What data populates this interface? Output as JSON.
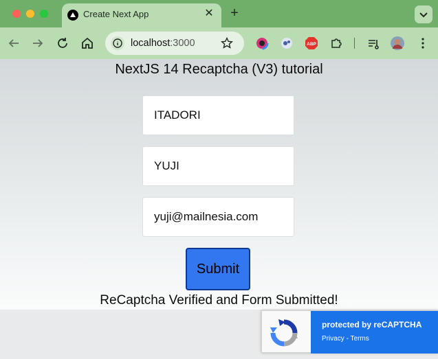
{
  "browser": {
    "tab_title": "Create Next App",
    "tab_close": "✕",
    "new_tab": "+",
    "url_host": "localhost",
    "url_port": ":3000",
    "icons": [
      "back-icon",
      "forward-icon",
      "reload-icon",
      "home-icon",
      "site-info-icon",
      "bookmark-star-icon",
      "color-extension-icon",
      "extension-icon",
      "adblock-icon",
      "puzzle-icon",
      "reading-list-icon",
      "profile-avatar",
      "more-menu-icon"
    ]
  },
  "page": {
    "heading": "NextJS 14 Recaptcha (V3) tutorial",
    "fields": {
      "first_name": "ITADORI",
      "last_name": "YUJI",
      "email": "yuji@mailnesia.com"
    },
    "submit_label": "Submit",
    "status": "ReCaptcha Verified and Form Submitted!"
  },
  "recaptcha": {
    "protected_label": "protected by reCAPTCHA",
    "privacy": "Privacy",
    "separator": " - ",
    "terms": "Terms"
  },
  "colors": {
    "titlebar": "#6faf6a",
    "toolbar": "#b9dcb3",
    "submit": "#3277f0",
    "recaptcha_panel": "#1a73e8"
  }
}
